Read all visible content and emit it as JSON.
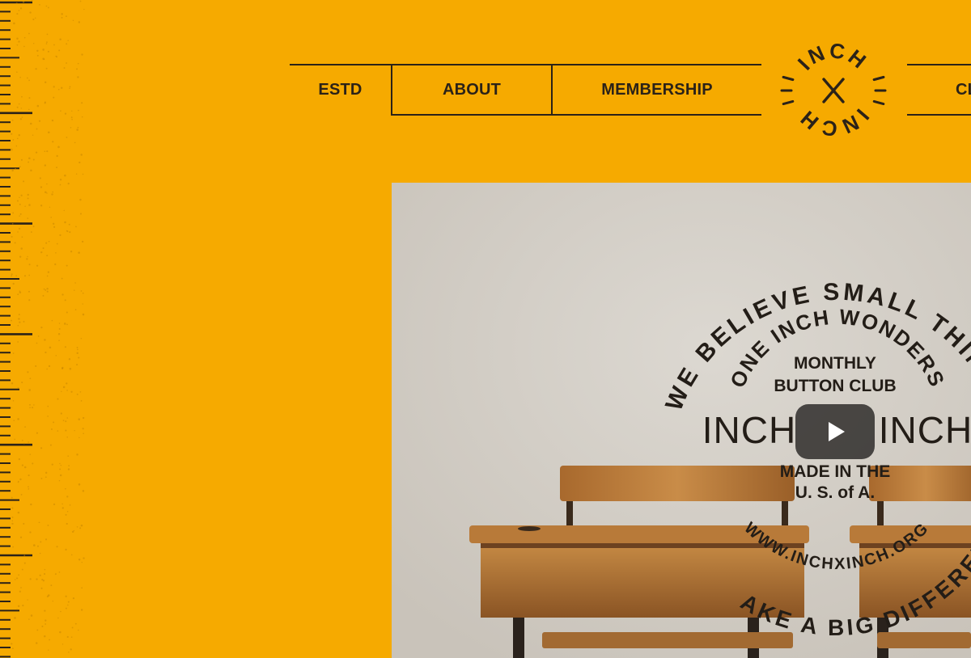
{
  "nav": {
    "items": [
      {
        "label": "ESTD"
      },
      {
        "label": "ABOUT"
      },
      {
        "label": "MEMBERSHIP"
      },
      {
        "label": "CL"
      }
    ]
  },
  "logo": {
    "text_top": "INCH",
    "text_bottom": "INCH",
    "center_mark": "×"
  },
  "video": {
    "badge": {
      "outer_top": "WE BELIEVE SMALL THINGS",
      "outer_bottom": "AKE A BIG DIFFERENCE.",
      "inner_top": "ONE INCH WONDERS",
      "inner_bottom": "WWW.INCHXINCH.ORG",
      "line1": "MONTHLY",
      "line2": "BUTTON CLUB",
      "brand_left": "INCH",
      "brand_right": "INCH",
      "made_line1": "MADE IN THE",
      "made_line2": "U. S. of A."
    }
  },
  "colors": {
    "background": "#f6aa00",
    "ink": "#2b2218",
    "video_backdrop": "#d4cfc7",
    "play_button": "#282624"
  }
}
